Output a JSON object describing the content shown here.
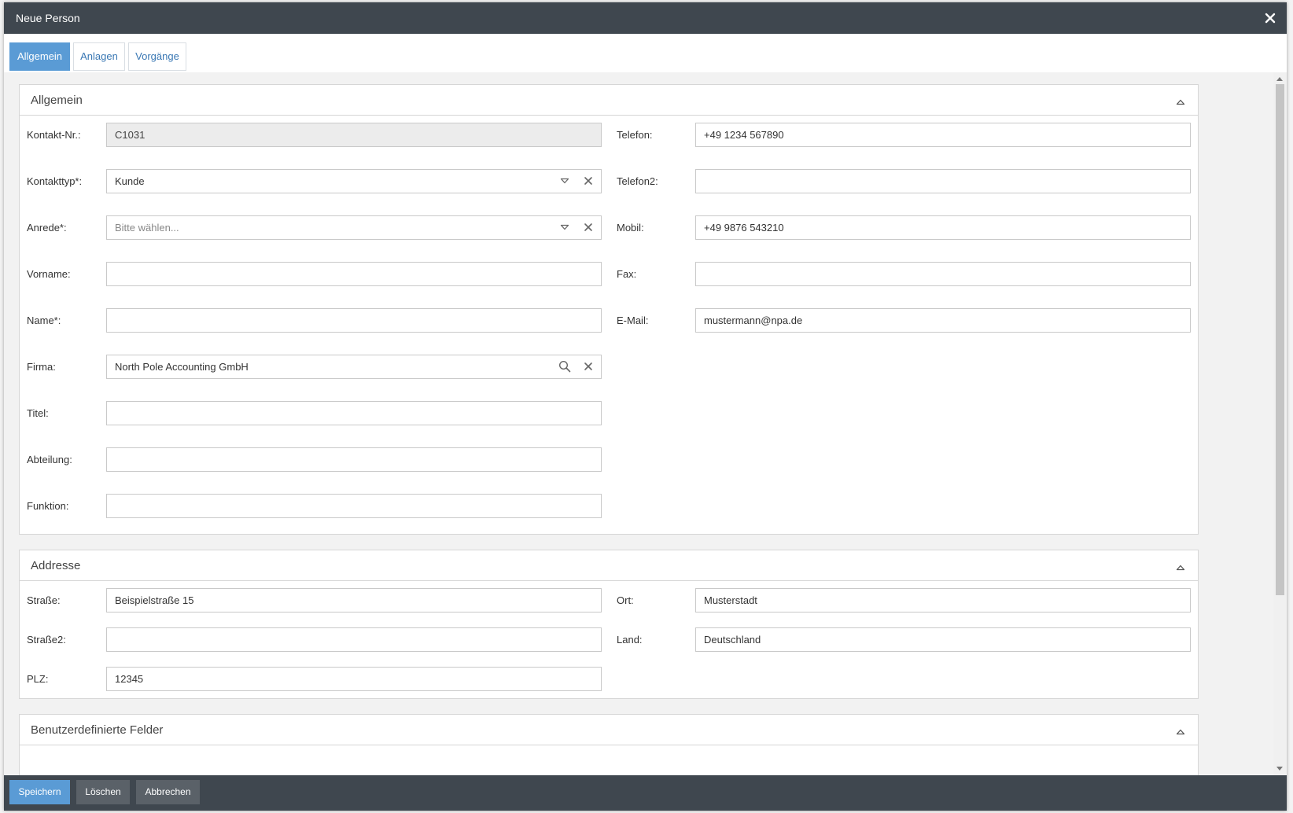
{
  "window": {
    "title": "Neue Person"
  },
  "tabs": [
    {
      "label": "Allgemein",
      "active": true
    },
    {
      "label": "Anlagen",
      "active": false
    },
    {
      "label": "Vorgänge",
      "active": false
    }
  ],
  "sections": {
    "allgemein": {
      "title": "Allgemein",
      "kontakt_nr": {
        "label": "Kontakt-Nr.:",
        "value": "C1031"
      },
      "kontakttyp": {
        "label": "Kontakttyp*:",
        "value": "Kunde"
      },
      "anrede": {
        "label": "Anrede*:",
        "value": "",
        "placeholder": "Bitte wählen..."
      },
      "vorname": {
        "label": "Vorname:",
        "value": ""
      },
      "name": {
        "label": "Name*:",
        "value": ""
      },
      "firma": {
        "label": "Firma:",
        "value": "North Pole Accounting GmbH"
      },
      "titel": {
        "label": "Titel:",
        "value": ""
      },
      "abteilung": {
        "label": "Abteilung:",
        "value": ""
      },
      "funktion": {
        "label": "Funktion:",
        "value": ""
      },
      "telefon": {
        "label": "Telefon:",
        "value": "+49 1234 567890"
      },
      "telefon2": {
        "label": "Telefon2:",
        "value": ""
      },
      "mobil": {
        "label": "Mobil:",
        "value": "+49 9876 543210"
      },
      "fax": {
        "label": "Fax:",
        "value": ""
      },
      "email": {
        "label": "E-Mail:",
        "value": "mustermann@npa.de"
      }
    },
    "adresse": {
      "title": "Addresse",
      "strasse": {
        "label": "Straße:",
        "value": "Beispielstraße 15"
      },
      "strasse2": {
        "label": "Straße2:",
        "value": ""
      },
      "plz": {
        "label": "PLZ:",
        "value": "12345"
      },
      "ort": {
        "label": "Ort:",
        "value": "Musterstadt"
      },
      "land": {
        "label": "Land:",
        "value": "Deutschland"
      }
    },
    "benutzerdefiniert": {
      "title": "Benutzerdefinierte Felder"
    }
  },
  "footer": {
    "save_label": "Speichern",
    "delete_label": "Löschen",
    "cancel_label": "Abbrechen"
  },
  "icons": {
    "close": "close-icon",
    "dropdown": "chevron-down-icon",
    "clear": "clear-icon",
    "search": "search-icon",
    "collapse": "chevron-up-icon"
  },
  "colors": {
    "titlebar": "#3f474f",
    "accent": "#5a9bd5",
    "tab_text": "#3a78b4",
    "footer_button": "#5a6168"
  }
}
